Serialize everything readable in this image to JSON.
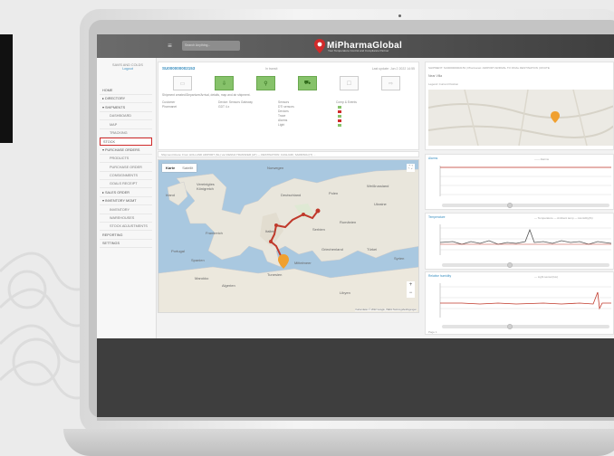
{
  "app": {
    "logo_text": "MiPharmaGlobal",
    "logo_tagline": "Your Temperature Control and Compliance Partner",
    "search_placeholder": "Search Anything...",
    "accent_red": "#d12a2a",
    "accent_blue": "#3a8fc0",
    "status_green": "#86c26a"
  },
  "user": {
    "name": "SAVIS AND COLDS",
    "link": "Logout"
  },
  "sidebar": {
    "items": [
      {
        "label": "HOME",
        "level": 0
      },
      {
        "label": "▸ DIRECTORY",
        "level": 0
      },
      {
        "label": "▾ SHIPMENTS",
        "level": 0
      },
      {
        "label": "DASHBOARD",
        "level": 1
      },
      {
        "label": "MAP",
        "level": 1
      },
      {
        "label": "TRACKING",
        "level": 1
      },
      {
        "label": "STOCK",
        "level": 0,
        "active": true
      },
      {
        "label": "▾ PURCHASE ORDERS",
        "level": 0
      },
      {
        "label": "PRODUCTS",
        "level": 1
      },
      {
        "label": "PURCHASE ORDER",
        "level": 1
      },
      {
        "label": "CONSIGNMENTS",
        "level": 1
      },
      {
        "label": "GOALS RECEIPT",
        "level": 1
      },
      {
        "label": "▸ SALES ORDER",
        "level": 0
      },
      {
        "label": "▾ INVENTORY MGMT",
        "level": 0
      },
      {
        "label": "INVENTORY",
        "level": 1
      },
      {
        "label": "WAREHOUSES",
        "level": 1
      },
      {
        "label": "STOCK ADJUSTMENTS",
        "level": 1
      },
      {
        "label": "REPORTING",
        "level": 0
      },
      {
        "label": "SETTINGS",
        "level": 0
      }
    ]
  },
  "shipment": {
    "id": "SU000000002153",
    "mid_label": "In transit",
    "right_label": "Last update: Jun 2 2022 14:55",
    "steps": [
      "▭",
      "⇩",
      "⚲",
      "⛟",
      "☐",
      "⇨"
    ],
    "info_line": "Shipment created/Departure/Arrival, details, map and air shipment.",
    "col1_label": "Customer",
    "col1_value": "Pharmanet",
    "col2_label": "Device: Sensors Gateway",
    "col2_value": "GDT 4.x",
    "col3_label": "Sensors",
    "col3_values": [
      "DTI sensors",
      "Devices",
      "Trace",
      "Alarms",
      "Light"
    ],
    "col4_label": "Comp & Events"
  },
  "route_bar": "Shipment Route: From HOLLAND AIRPORT (NL) via VIENNA TRANSFER (AT) — DESTINATION: CAGLIARI, SARDINIA (IT) ...",
  "map": {
    "tab_map": "Karte",
    "tab_sat": "Satellit",
    "fullscreen_icon": "⛶",
    "zoom_in": "+",
    "zoom_out": "−",
    "attribution": "Kartendaten © 2022 Google, INEGI   Nutzungsbedingungen",
    "labels": [
      {
        "t": "Vereinigtes"
      },
      {
        "t": "Königreich"
      },
      {
        "t": "Irland"
      },
      {
        "t": "Frankreich"
      },
      {
        "t": "Spanien"
      },
      {
        "t": "Portugal"
      },
      {
        "t": "Italien"
      },
      {
        "t": "Deutschland"
      },
      {
        "t": "Polen"
      },
      {
        "t": "Ukraine"
      },
      {
        "t": "Rumänien"
      },
      {
        "t": "Türkei"
      },
      {
        "t": "Algerien"
      },
      {
        "t": "Libyen"
      },
      {
        "t": "Tunesien"
      },
      {
        "t": "Marokko"
      },
      {
        "t": "Griechenland"
      },
      {
        "t": "Weißrussland"
      },
      {
        "t": "Norwegen"
      },
      {
        "t": "Syrien"
      },
      {
        "t": "Mittelmeer"
      },
      {
        "t": "Serbien"
      }
    ]
  },
  "right_top": {
    "header": "SHIPMENT: SU000000002153 | Pharmanet: AIRPORT ARRIVAL TO FINAL DESTINATION | ROUTE",
    "subtitle": "Near Villa",
    "subtitle2": "Legend: Current Position"
  },
  "panels": [
    {
      "title": "Alarms",
      "legend": "—— Alarms"
    },
    {
      "title": "Temperature",
      "legend": "— Temperature  — Ambient temp  — Humidity(%)"
    },
    {
      "title": "Relative humidity",
      "legend": "— Light sensor(lux)"
    }
  ],
  "bottom_label": "Page 1"
}
